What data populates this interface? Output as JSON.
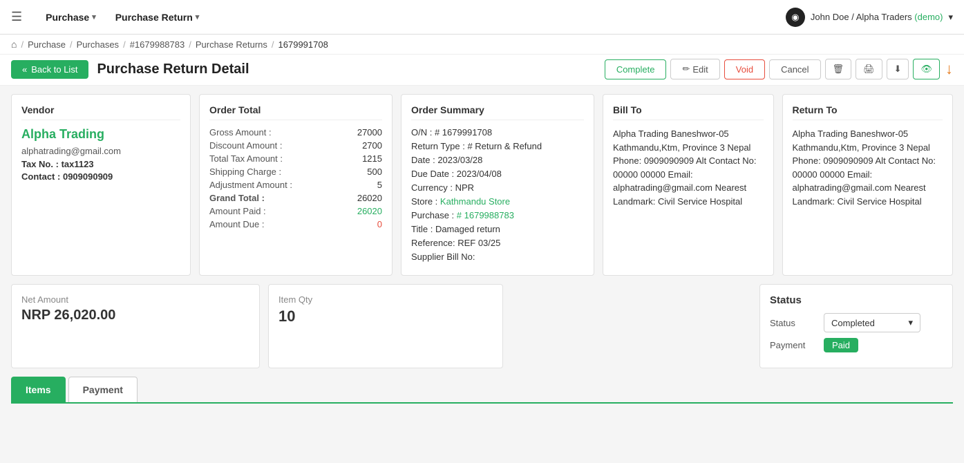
{
  "nav": {
    "hamburger_label": "☰",
    "menu_items": [
      {
        "label": "Purchase",
        "chevron": "▾"
      },
      {
        "label": "Purchase Return",
        "chevron": "▾"
      }
    ],
    "user": {
      "name": "John Doe",
      "separator": " / ",
      "company": "Alpha Traders",
      "demo": "(demo)",
      "chevron": "▾",
      "avatar": "◉"
    }
  },
  "breadcrumb": {
    "home_icon": "⌂",
    "items": [
      {
        "label": "Purchase",
        "link": true
      },
      {
        "label": "Purchases",
        "link": true
      },
      {
        "label": "#1679988783",
        "link": true
      },
      {
        "label": "Purchase Returns",
        "link": true
      },
      {
        "label": "1679991708",
        "link": false
      }
    ]
  },
  "page": {
    "title": "Purchase Return Detail"
  },
  "buttons": {
    "back": "Back to List",
    "complete": "Complete",
    "edit": "Edit",
    "void": "Void",
    "cancel": "Cancel",
    "delete_icon": "🗑",
    "print_icon": "🖨",
    "download_icon": "⬇",
    "eye_icon": "👁"
  },
  "vendor": {
    "section_label": "Vendor",
    "name": "Alpha Trading",
    "email": "alphatrading@gmail.com",
    "tax_label": "Tax No. :",
    "tax_value": "tax1123",
    "contact_label": "Contact :",
    "contact_value": "0909090909"
  },
  "order_total": {
    "section_label": "Order Total",
    "rows": [
      {
        "label": "Gross Amount :",
        "value": "27000",
        "style": "normal"
      },
      {
        "label": "Discount Amount :",
        "value": "2700",
        "style": "normal"
      },
      {
        "label": "Total Tax Amount :",
        "value": "1215",
        "style": "normal"
      },
      {
        "label": "Shipping Charge :",
        "value": "500",
        "style": "normal"
      },
      {
        "label": "Adjustment Amount :",
        "value": "5",
        "style": "normal"
      },
      {
        "label": "Grand Total :",
        "value": "26020",
        "style": "grand"
      },
      {
        "label": "Amount Paid :",
        "value": "26020",
        "style": "green"
      },
      {
        "label": "Amount Due :",
        "value": "0",
        "style": "red"
      }
    ]
  },
  "order_summary": {
    "section_label": "Order Summary",
    "rows": [
      {
        "label": "O/N :",
        "value": "# 1679991708",
        "style": "normal"
      },
      {
        "label": "Return Type :",
        "value": "# Return & Refund",
        "style": "normal"
      },
      {
        "label": "Date :",
        "value": "2023/03/28",
        "style": "normal"
      },
      {
        "label": "Due Date :",
        "value": "2023/04/08",
        "style": "normal"
      },
      {
        "label": "Currency :",
        "value": "NPR",
        "style": "normal"
      },
      {
        "label": "Store :",
        "value": "Kathmandu Store",
        "style": "green"
      },
      {
        "label": "Purchase :",
        "value": "# 1679988783",
        "style": "green"
      },
      {
        "label": "Title :",
        "value": "Damaged return",
        "style": "normal"
      },
      {
        "label": "Reference:",
        "value": "REF 03/25",
        "style": "normal"
      },
      {
        "label": "Supplier Bill No:",
        "value": "",
        "style": "normal"
      }
    ]
  },
  "bill_to": {
    "section_label": "Bill To",
    "address": "Alpha Trading Baneshwor-05 Kathmandu,Ktm, Province 3 Nepal Phone: 0909090909 Alt Contact No: 00000 00000 Email: alphatrading@gmail.com Nearest Landmark: Civil Service Hospital"
  },
  "return_to": {
    "section_label": "Return To",
    "address": "Alpha Trading Baneshwor-05 Kathmandu,Ktm, Province 3 Nepal Phone: 0909090909 Alt Contact No: 00000 00000 Email: alphatrading@gmail.com Nearest Landmark: Civil Service Hospital"
  },
  "net_amount": {
    "label": "Net Amount",
    "value": "NRP 26,020.00"
  },
  "item_qty": {
    "label": "Item Qty",
    "value": "10"
  },
  "status": {
    "section_label": "Status",
    "status_label": "Status",
    "status_value": "Completed",
    "payment_label": "Payment",
    "payment_value": "Paid",
    "chevron": "▾"
  },
  "tabs": [
    {
      "label": "Items",
      "active": true
    },
    {
      "label": "Payment",
      "active": false
    }
  ]
}
